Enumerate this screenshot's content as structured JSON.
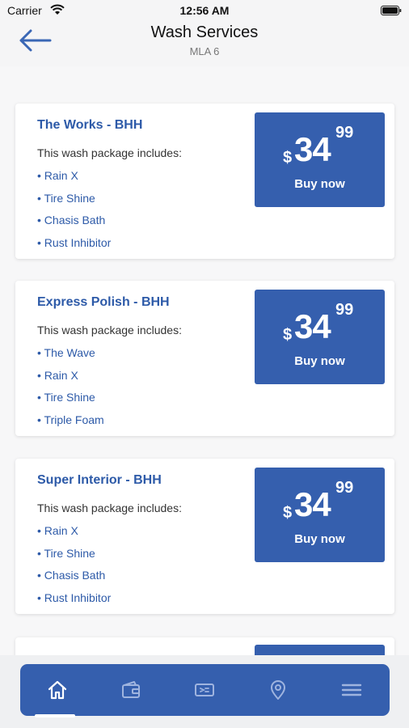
{
  "status_bar": {
    "carrier": "Carrier",
    "time": "12:56 AM"
  },
  "header": {
    "title": "Wash Services",
    "subtitle": "MLA 6"
  },
  "cards": [
    {
      "title": "The Works - BHH",
      "includes_label": "This wash package includes:",
      "items": [
        "• Rain X",
        "• Tire Shine",
        "• Chasis Bath",
        "• Rust Inhibitor"
      ],
      "price": {
        "currency": "$",
        "dollars": "34",
        "cents": "99"
      },
      "buy_label": "Buy now"
    },
    {
      "title": "Express Polish - BHH",
      "includes_label": "This wash package includes:",
      "items": [
        "• The Wave",
        "• Rain X",
        "• Tire Shine",
        "• Triple Foam"
      ],
      "price": {
        "currency": "$",
        "dollars": "34",
        "cents": "99"
      },
      "buy_label": "Buy now"
    },
    {
      "title": "Super Interior - BHH",
      "includes_label": "This wash package includes:",
      "items": [
        "• Rain X",
        "• Tire Shine",
        "• Chasis Bath",
        "• Rust Inhibitor"
      ],
      "price": {
        "currency": "$",
        "dollars": "34",
        "cents": "99"
      },
      "buy_label": "Buy now"
    }
  ],
  "tab_bar": {
    "tabs": [
      {
        "icon": "home-icon",
        "active": true
      },
      {
        "icon": "wallet-icon",
        "active": false
      },
      {
        "icon": "ticket-icon",
        "active": false
      },
      {
        "icon": "location-pin-icon",
        "active": false
      },
      {
        "icon": "menu-icon",
        "active": false
      }
    ]
  },
  "colors": {
    "accent": "#355fae",
    "title_text": "#2d5aa8",
    "background": "#f7f7f8"
  }
}
